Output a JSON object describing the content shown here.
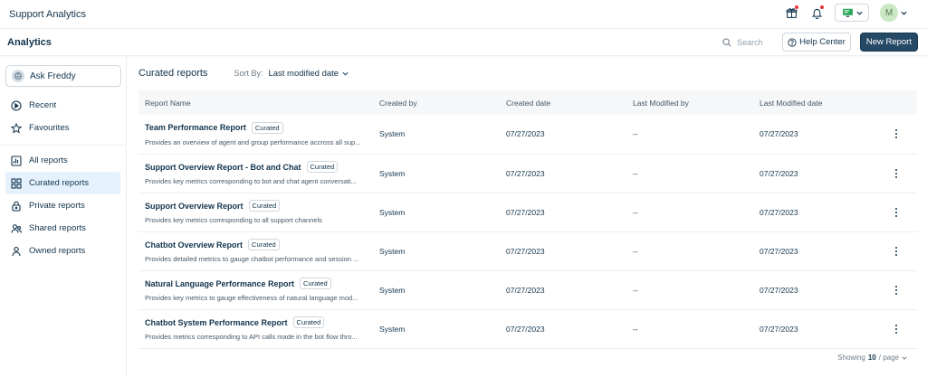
{
  "app": {
    "title": "Support Analytics"
  },
  "topbar": {
    "icons": [
      "gift-icon",
      "bell-icon",
      "monitor-icon",
      "chevron-down-icon"
    ],
    "avatar_initial": "M",
    "notification_dot_color": "#e43538"
  },
  "header": {
    "title": "Analytics",
    "search_placeholder": "Search",
    "help_label": "Help Center",
    "new_report_label": "New Report"
  },
  "sidebar": {
    "ask_freddy": "Ask Freddy",
    "items": [
      {
        "label": "Recent",
        "icon": "clock-play-icon"
      },
      {
        "label": "Favourites",
        "icon": "star-icon"
      },
      {
        "label": "All reports",
        "icon": "chart-icon"
      },
      {
        "label": "Curated reports",
        "icon": "grid-icon",
        "active": true
      },
      {
        "label": "Private reports",
        "icon": "lock-icon"
      },
      {
        "label": "Shared reports",
        "icon": "users-icon"
      },
      {
        "label": "Owned reports",
        "icon": "user-icon"
      }
    ]
  },
  "main": {
    "section_title": "Curated reports",
    "sort_label": "Sort By:",
    "sort_value": "Last modified date",
    "columns": [
      "Report Name",
      "Created by",
      "Created date",
      "Last Modified by",
      "Last Modified date"
    ],
    "rows": [
      {
        "name": "Team Performance Report",
        "badge": "Curated",
        "desc": "Provides an overview of agent and group performance accross all sup...",
        "created_by": "System",
        "created_date": "07/27/2023",
        "modified_by": "--",
        "modified_date": "07/27/2023"
      },
      {
        "name": "Support Overview Report - Bot and Chat",
        "badge": "Curated",
        "desc": "Provides key metrics corresponding to bot and chat agent conversati...",
        "created_by": "System",
        "created_date": "07/27/2023",
        "modified_by": "--",
        "modified_date": "07/27/2023"
      },
      {
        "name": "Support Overview Report",
        "badge": "Curated",
        "desc": "Provides key metrics corresponding to all support channels",
        "created_by": "System",
        "created_date": "07/27/2023",
        "modified_by": "--",
        "modified_date": "07/27/2023"
      },
      {
        "name": "Chatbot Overview Report",
        "badge": "Curated",
        "desc": "Provides detailed metrics to gauge chatbot performance and session ...",
        "created_by": "System",
        "created_date": "07/27/2023",
        "modified_by": "--",
        "modified_date": "07/27/2023"
      },
      {
        "name": "Natural Language Performance Report",
        "badge": "Curated",
        "desc": "Provides key metrics to gauge effectiveness of natural language mod...",
        "created_by": "System",
        "created_date": "07/27/2023",
        "modified_by": "--",
        "modified_date": "07/27/2023"
      },
      {
        "name": "Chatbot System Performance Report",
        "badge": "Curated",
        "desc": "Provides metrics corresponding to API calls made in the bot flow thro...",
        "created_by": "System",
        "created_date": "07/27/2023",
        "modified_by": "--",
        "modified_date": "07/27/2023"
      }
    ]
  },
  "pagination": {
    "prefix": "Showing",
    "count": "10",
    "suffix": "/ page"
  },
  "colors": {
    "primary_button": "#264966",
    "active_nav": "#e5f2fd",
    "text": "#12344d"
  }
}
